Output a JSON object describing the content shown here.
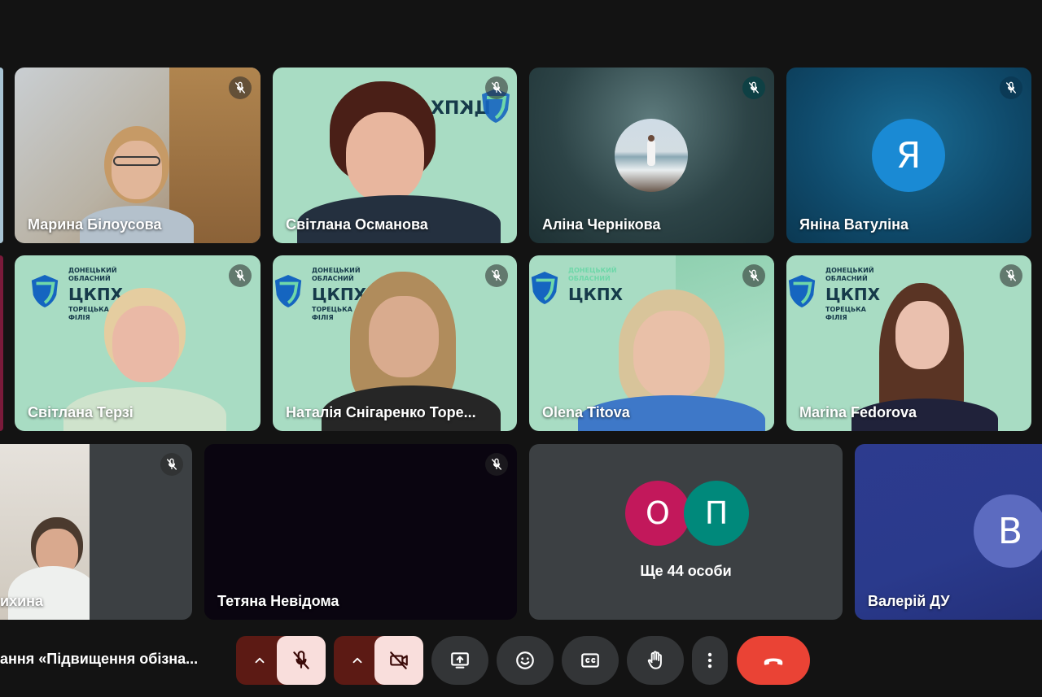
{
  "participants": [
    {
      "name": "Марина Білоусова"
    },
    {
      "name": "Світлана Османова"
    },
    {
      "name": "Аліна Чернікова"
    },
    {
      "name": "Яніна Ватуліна",
      "initial": "Я"
    },
    {
      "name": "Світлана Терзі"
    },
    {
      "name": "Наталія Снігаренко Торе..."
    },
    {
      "name": "Olena Titova"
    },
    {
      "name": "Marina Fedorova"
    },
    {
      "name": "ихина"
    },
    {
      "name": "Тетяна Невідома"
    },
    {
      "name": "Валерій ДУ",
      "initial": "В"
    }
  ],
  "others": {
    "label": "Ще 44 особи",
    "initials": [
      "О",
      "П"
    ]
  },
  "background_logo": {
    "line1": "ДОНЕЦЬКИЙ",
    "line2": "ОБЛАСНИЙ",
    "abbr": "ЦКПХ",
    "line3": "ТОРЕЦЬКА",
    "line4": "ФІЛІЯ"
  },
  "meeting_title": "ання «Підвищення обізна...",
  "colors": {
    "accent_red": "#ea4335",
    "muted_bg": "#5c1a14",
    "muted_fg": "#f9dedc",
    "background": "#131313",
    "control_bg": "#333537",
    "logo_bg": "#a8dcc3"
  },
  "icons": {
    "mic": "mic-off-icon",
    "camera": "camera-off-icon",
    "present": "present-screen-icon",
    "emoji": "emoji-icon",
    "captions": "captions-icon",
    "hand": "raise-hand-icon",
    "more": "more-vert-icon",
    "hangup": "hangup-icon"
  }
}
